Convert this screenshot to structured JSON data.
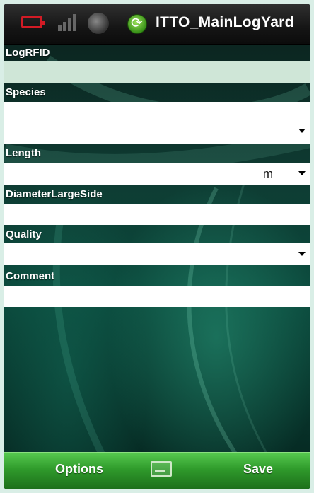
{
  "status_bar": {
    "app_title": "ITTO_MainLogYard",
    "icons": [
      "battery-icon",
      "signal-icon",
      "globe-icon",
      "sync-icon"
    ],
    "battery_color": "#d21b25"
  },
  "form": {
    "log_rfid": {
      "label": "LogRFID",
      "value": ""
    },
    "species": {
      "label": "Species",
      "value": ""
    },
    "length": {
      "label": "Length",
      "value": "",
      "unit": "m"
    },
    "diameter": {
      "label": "DiameterLargeSide",
      "value": ""
    },
    "quality": {
      "label": "Quality",
      "value": ""
    },
    "comment": {
      "label": "Comment",
      "value": ""
    }
  },
  "menu_bar": {
    "left_label": "Options",
    "right_label": "Save",
    "center_icon": "keyboard-icon",
    "color": "#2f9a2b"
  }
}
